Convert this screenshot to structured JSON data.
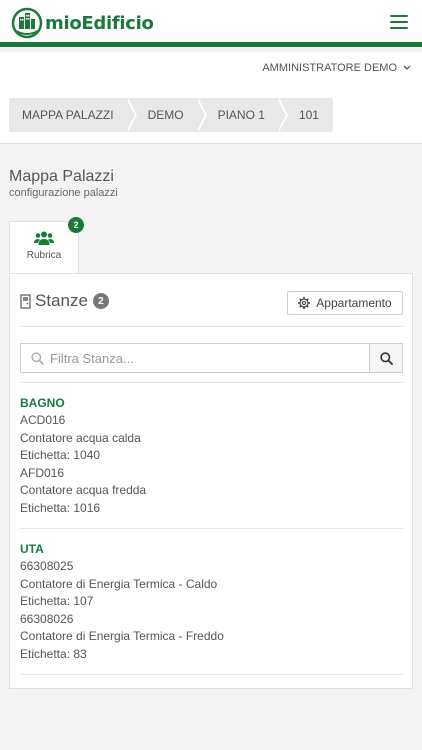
{
  "brand": {
    "name": "mioEdificio",
    "color": "#1b7a3b"
  },
  "user_menu": {
    "label": "AMMINISTRATORE DEMO"
  },
  "breadcrumb": [
    "MAPPA PALAZZI",
    "DEMO",
    "PIANO 1",
    "101"
  ],
  "page": {
    "title": "Mappa Palazzi",
    "subtitle": "configurazione palazzi"
  },
  "tab": {
    "label": "Rubrica",
    "badge": "2",
    "icon": "users-icon"
  },
  "panel": {
    "title": "Stanze",
    "count": "2",
    "button_label": "Appartamento",
    "button_icon": "gear-icon",
    "title_icon": "door-icon"
  },
  "search": {
    "placeholder": "Filtra Stanza...",
    "value": ""
  },
  "rooms": [
    {
      "name": "BAGNO",
      "lines": [
        "ACD016",
        "Contatore acqua calda",
        "Etichetta: 1040",
        "AFD016",
        "Contatore acqua fredda",
        "Etichetta: 1016"
      ]
    },
    {
      "name": "UTA",
      "lines": [
        "66308025",
        "Contatore di Energia Termica - Caldo",
        "Etichetta: 107",
        "66308026",
        "Contatore di Energia Termica - Freddo",
        "Etichetta: 83"
      ]
    }
  ]
}
